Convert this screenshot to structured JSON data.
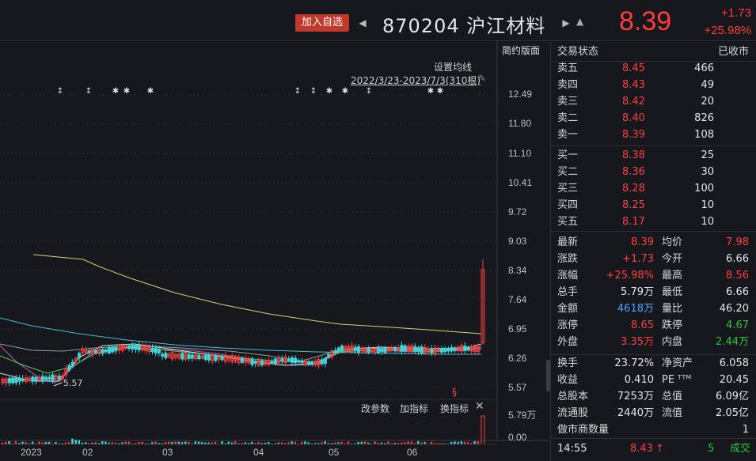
{
  "header": {
    "add_watchlist": "加入自选",
    "code_name": "870204 沪江材料",
    "price": "8.39",
    "change": "+1.73",
    "change_pct": "+25.98%"
  },
  "chart": {
    "settings_label": "设置均线",
    "range_label": "2022/3/23-2023/7/3(310根)",
    "simple_layout": "简约版面",
    "low_marker": "5.57",
    "y_ticks": [
      "12.49",
      "11.80",
      "11.10",
      "10.41",
      "9.72",
      "9.03",
      "8.34",
      "7.64",
      "6.95",
      "6.26",
      "5.57"
    ],
    "x_ticks": [
      "2023",
      "02",
      "03",
      "04",
      "05",
      "06"
    ],
    "vol_ticks": [
      "5.79万",
      "0.00"
    ],
    "bottom_menu": {
      "params": "改参数",
      "add": "加指标",
      "switch": "换指标"
    }
  },
  "chart_data": {
    "type": "candlestick",
    "y_range": [
      5.57,
      12.49
    ],
    "last_close": 8.39,
    "high": 8.56,
    "low_marker": 5.57
  },
  "panel": {
    "status_label": "交易状态",
    "status_value": "已收市",
    "asks": [
      {
        "label": "卖五",
        "price": "8.45",
        "vol": "466"
      },
      {
        "label": "卖四",
        "price": "8.43",
        "vol": "49"
      },
      {
        "label": "卖三",
        "price": "8.42",
        "vol": "20"
      },
      {
        "label": "卖二",
        "price": "8.40",
        "vol": "826"
      },
      {
        "label": "卖一",
        "price": "8.39",
        "vol": "108"
      }
    ],
    "bids": [
      {
        "label": "买一",
        "price": "8.38",
        "vol": "25"
      },
      {
        "label": "买二",
        "price": "8.36",
        "vol": "30"
      },
      {
        "label": "买三",
        "price": "8.28",
        "vol": "100"
      },
      {
        "label": "买四",
        "price": "8.25",
        "vol": "10"
      },
      {
        "label": "买五",
        "price": "8.17",
        "vol": "10"
      }
    ],
    "quote": [
      {
        "l1": "最新",
        "v1": "8.39",
        "c1": "red",
        "l2": "均价",
        "v2": "7.98",
        "c2": "red"
      },
      {
        "l1": "涨跌",
        "v1": "+1.73",
        "c1": "red",
        "l2": "今开",
        "v2": "6.66",
        "c2": "white"
      },
      {
        "l1": "涨幅",
        "v1": "+25.98%",
        "c1": "red",
        "l2": "最高",
        "v2": "8.56",
        "c2": "red"
      },
      {
        "l1": "总手",
        "v1": "5.79万",
        "c1": "white",
        "l2": "最低",
        "v2": "6.66",
        "c2": "white"
      },
      {
        "l1": "金额",
        "v1": "4618万",
        "c1": "blue",
        "l2": "量比",
        "v2": "46.20",
        "c2": "white"
      },
      {
        "l1": "涨停",
        "v1": "8.65",
        "c1": "red",
        "l2": "跌停",
        "v2": "4.67",
        "c2": "green"
      },
      {
        "l1": "外盘",
        "v1": "3.35万",
        "c1": "red",
        "l2": "内盘",
        "v2": "2.44万",
        "c2": "green"
      }
    ],
    "fundamentals": [
      {
        "l1": "换手",
        "v1": "23.72%",
        "l2": "净资产",
        "v2": "6.058"
      },
      {
        "l1": "收益",
        "v1": "0.410",
        "l2": "PE ᵀᵀᴹ",
        "v2": "20.45"
      },
      {
        "l1": "总股本",
        "v1": "7253万",
        "l2": "总值",
        "v2": "6.09亿"
      },
      {
        "l1": "流通股",
        "v1": "2440万",
        "l2": "流值",
        "v2": "2.05亿"
      }
    ],
    "mm_label": "做市商数量",
    "mm_value": "1",
    "tick": {
      "time": "14:55",
      "price": "8.43",
      "arrow": "↑",
      "vol": "5",
      "note": "成交"
    }
  }
}
